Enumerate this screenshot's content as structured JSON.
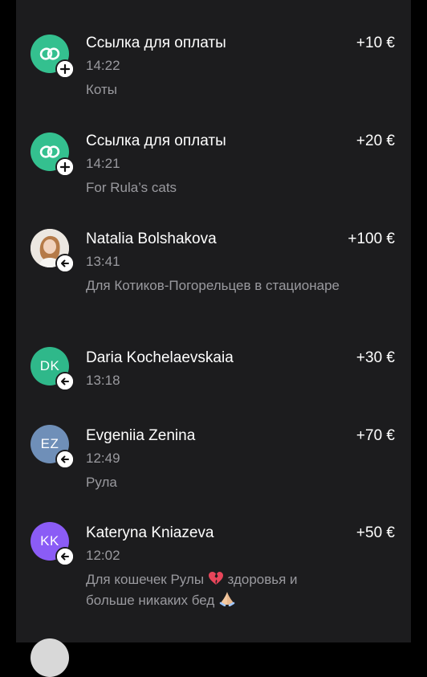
{
  "transactions": [
    {
      "title": "Ссылка для оплаты",
      "time": "14:22",
      "note": "Коты",
      "amount": "+10 €",
      "avatar_type": "link-icon",
      "avatar_color": "#34c08f",
      "badge": "plus-icon"
    },
    {
      "title": "Ссылка для оплаты",
      "time": "14:21",
      "note": "For Rula’s cats",
      "amount": "+20 €",
      "avatar_type": "link-icon",
      "avatar_color": "#34c08f",
      "badge": "plus-icon"
    },
    {
      "title": "Natalia Bolshakova",
      "time": "13:41",
      "note": "Для Котиков-Погорельцев в стационаре",
      "amount": "+100 €",
      "avatar_type": "photo",
      "badge": "arrow-left-icon"
    },
    {
      "title": "Daria Kochelaevskaia",
      "time": "13:18",
      "note": "",
      "amount": "+30 €",
      "avatar_type": "initials",
      "initials": "DK",
      "avatar_color": "#2fb88a",
      "badge": "arrow-left-icon"
    },
    {
      "title": "Evgeniia Zenina",
      "time": "12:49",
      "note": "Рула",
      "amount": "+70 €",
      "avatar_type": "initials",
      "initials": "EZ",
      "avatar_color": "#6f8fb8",
      "badge": "arrow-left-icon"
    },
    {
      "title": "Kateryna Kniazeva",
      "time": "12:02",
      "note_part1": "Для кошечек Рулы",
      "note_part2": "здоровья и больше никаких бед",
      "emoji1": "broken-heart-emoji",
      "emoji2": "folded-hands-emoji",
      "amount": "+50 €",
      "avatar_type": "initials",
      "initials": "KK",
      "avatar_color": "#8b5cf6",
      "badge": "arrow-left-icon"
    }
  ]
}
